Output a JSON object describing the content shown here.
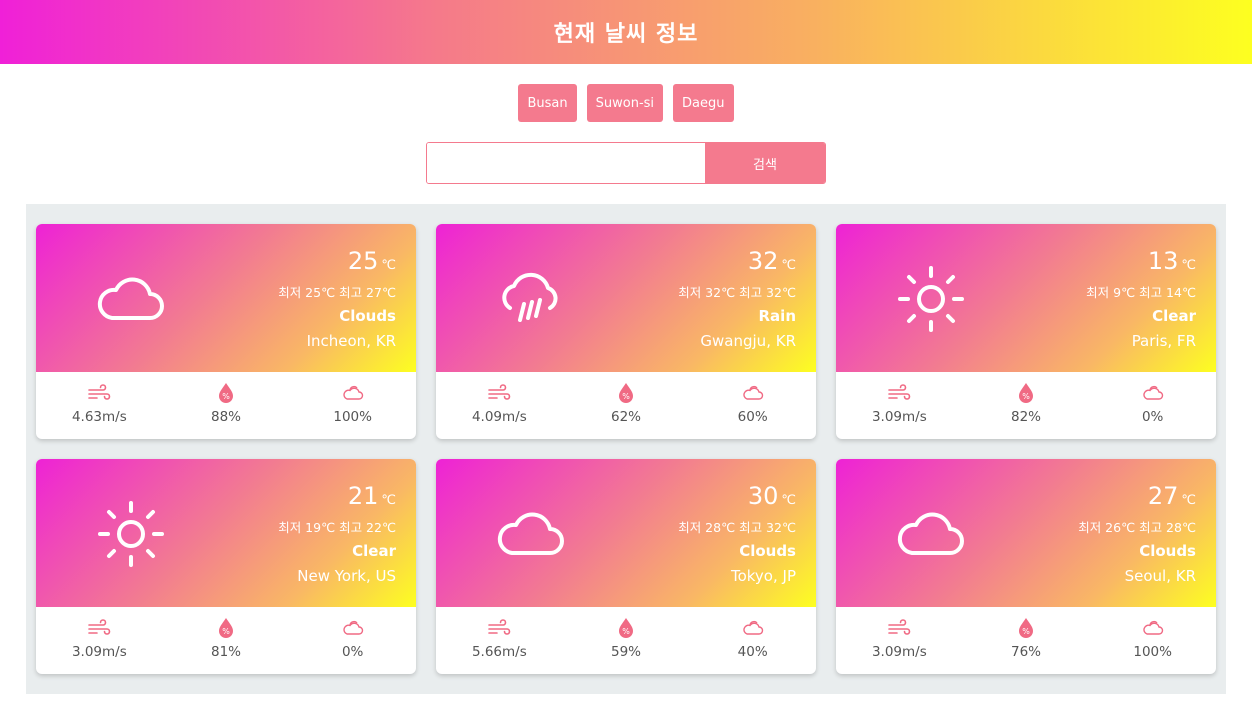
{
  "header": {
    "title": "현재 날씨 정보"
  },
  "city_buttons": [
    "Busan",
    "Suwon-si",
    "Daegu"
  ],
  "search": {
    "value": "",
    "placeholder": "",
    "button_label": "검색"
  },
  "colors": {
    "accent": "#f47a8e",
    "gradient_start": "#ee22d6",
    "gradient_end": "#fdff20"
  },
  "unit": "℃",
  "cards": [
    {
      "icon": "cloud-icon",
      "temp": "25",
      "minmax": "최저 25℃ 최고 27℃",
      "desc": "Clouds",
      "location": "Incheon, KR",
      "wind": "4.63m/s",
      "humidity": "88%",
      "cloudiness": "100%"
    },
    {
      "icon": "rain-icon",
      "temp": "32",
      "minmax": "최저 32℃ 최고 32℃",
      "desc": "Rain",
      "location": "Gwangju, KR",
      "wind": "4.09m/s",
      "humidity": "62%",
      "cloudiness": "60%"
    },
    {
      "icon": "sun-icon",
      "temp": "13",
      "minmax": "최저 9℃ 최고 14℃",
      "desc": "Clear",
      "location": "Paris, FR",
      "wind": "3.09m/s",
      "humidity": "82%",
      "cloudiness": "0%"
    },
    {
      "icon": "sun-icon",
      "temp": "21",
      "minmax": "최저 19℃ 최고 22℃",
      "desc": "Clear",
      "location": "New York, US",
      "wind": "3.09m/s",
      "humidity": "81%",
      "cloudiness": "0%"
    },
    {
      "icon": "cloud-icon",
      "temp": "30",
      "minmax": "최저 28℃ 최고 32℃",
      "desc": "Clouds",
      "location": "Tokyo, JP",
      "wind": "5.66m/s",
      "humidity": "59%",
      "cloudiness": "40%"
    },
    {
      "icon": "cloud-icon",
      "temp": "27",
      "minmax": "최저 26℃ 최고 28℃",
      "desc": "Clouds",
      "location": "Seoul, KR",
      "wind": "3.09m/s",
      "humidity": "76%",
      "cloudiness": "100%"
    }
  ]
}
